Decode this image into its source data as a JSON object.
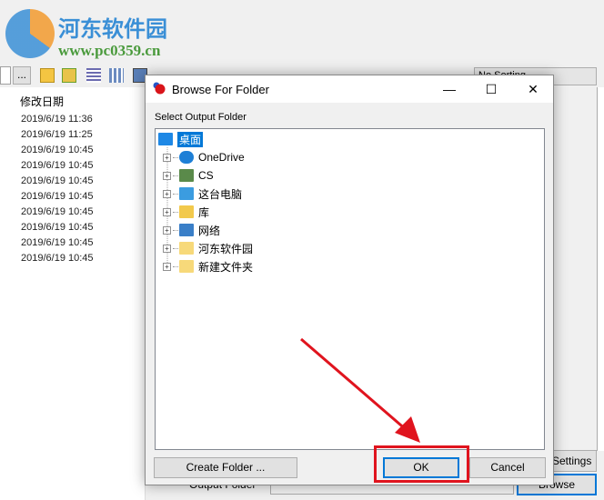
{
  "watermark": {
    "title": "河东软件园",
    "url": "www.pc0359.cn"
  },
  "background": {
    "browse_dots": "...",
    "sort_select": "No Sorting",
    "column_header": "修改日期",
    "dates": [
      "2019/6/19 11:36",
      "2019/6/19 11:25",
      "2019/6/19 10:45",
      "2019/6/19 10:45",
      "2019/6/19 10:45",
      "2019/6/19 10:45",
      "2019/6/19 10:45",
      "2019/6/19 10:45",
      "2019/6/19 10:45",
      "2019/6/19 10:45"
    ],
    "settings_label": "Settings",
    "output_folder_label": "Output Folder",
    "browse_label": "Browse"
  },
  "dialog": {
    "title": "Browse For Folder",
    "minimize": "—",
    "maximize": "☐",
    "close": "✕",
    "instruction": "Select Output Folder",
    "tree": [
      {
        "label": "桌面",
        "icon": "desktop-icon",
        "selected": true
      },
      {
        "label": "OneDrive",
        "icon": "cloud-icon"
      },
      {
        "label": "CS",
        "icon": "user-icon"
      },
      {
        "label": "这台电脑",
        "icon": "computer-icon"
      },
      {
        "label": "库",
        "icon": "library-icon"
      },
      {
        "label": "网络",
        "icon": "network-icon"
      },
      {
        "label": "河东软件园",
        "icon": "folder-icon"
      },
      {
        "label": "新建文件夹",
        "icon": "folder-icon"
      }
    ],
    "expander": "+",
    "create_folder": "Create Folder ...",
    "ok": "OK",
    "cancel": "Cancel"
  },
  "colors": {
    "accent": "#0078d7",
    "highlight": "#e0141e"
  }
}
